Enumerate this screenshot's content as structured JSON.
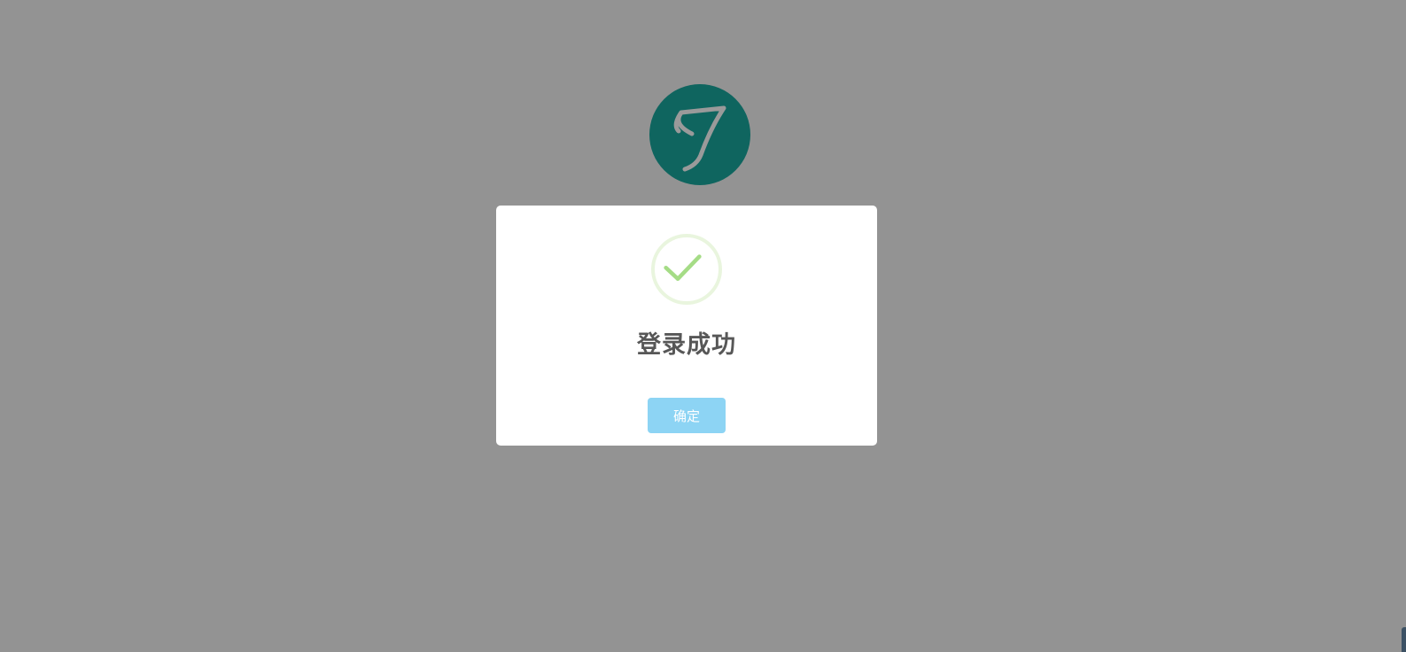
{
  "logo": {
    "icon": "script-j-logo",
    "background_color": "#0f655f",
    "mark_color": "#9a9a9a"
  },
  "overlay": {
    "color": "#939393"
  },
  "dialog": {
    "icon": "success-check-icon",
    "check_color": "#a5dc86",
    "ring_color": "#e9f5de",
    "title": "登录成功",
    "confirm_label": "确定",
    "confirm_color": "#8dd4f4"
  }
}
